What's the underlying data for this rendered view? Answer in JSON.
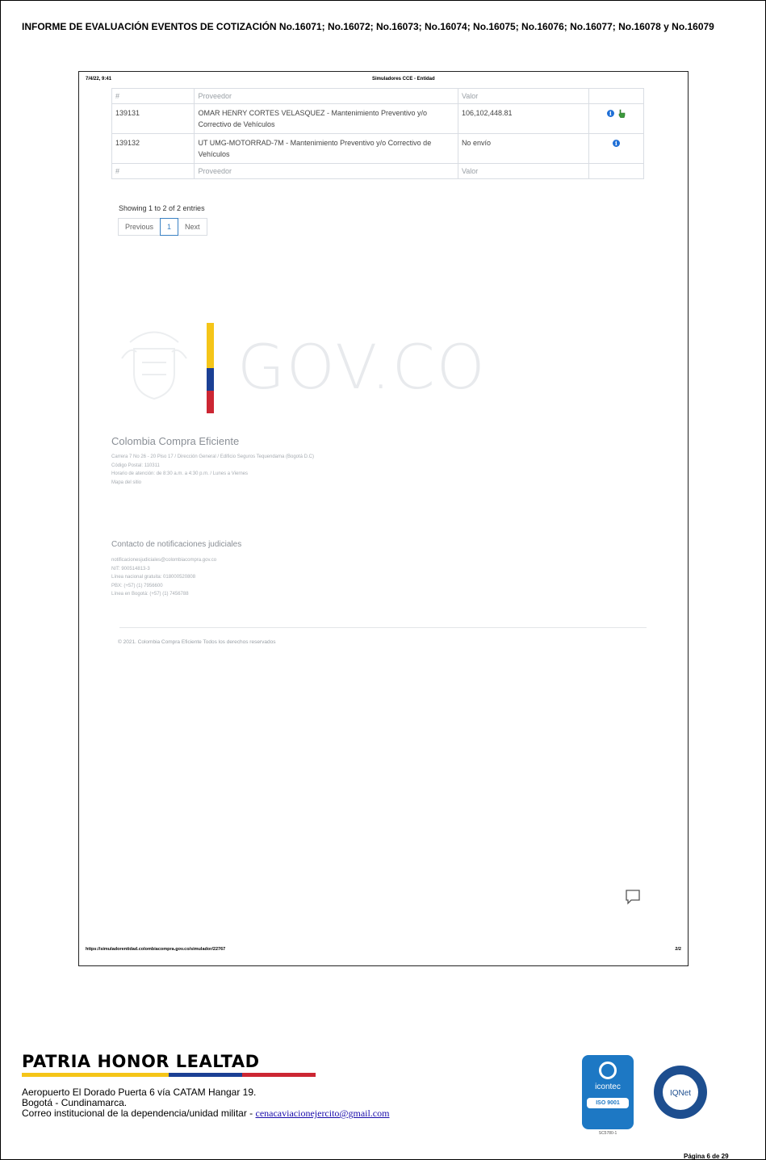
{
  "report": {
    "title": "INFORME DE EVALUACIÓN EVENTOS DE COTIZACIÓN No.16071; No.16072; No.16073; No.16074; No.16075; No.16076; No.16077; No.16078 y No.16079"
  },
  "print_header": {
    "date": "7/4/22, 9:41",
    "site": "Simuladores CCE - Entidad"
  },
  "table": {
    "headers": [
      "#",
      "Proveedor",
      "Valor",
      ""
    ],
    "rows": [
      {
        "id": "139131",
        "proveedor": "OMAR HENRY CORTES VELASQUEZ - Mantenimiento Preventivo y/o Correctivo de Vehículos",
        "valor": "106,102,448.81",
        "icons": [
          "info-icon",
          "hand-pointer-icon"
        ]
      },
      {
        "id": "139132",
        "proveedor": "UT UMG-MOTORRAD-7M - Mantenimiento Preventivo y/o Correctivo de Vehículos",
        "valor": "No envío",
        "icons": [
          "info-icon"
        ]
      }
    ],
    "footers": [
      "#",
      "Proveedor",
      "Valor",
      ""
    ]
  },
  "pagination": {
    "showing": "Showing 1 to 2 of 2 entries",
    "previous": "Previous",
    "current": "1",
    "next": "Next"
  },
  "govco": {
    "text": "GOV.CO",
    "flag_colors": [
      "#f5c518",
      "#1b3f94",
      "#cc2633"
    ]
  },
  "cce": {
    "title": "Colombia Compra Eficiente",
    "lines": [
      "Carrera 7 No 26 - 20 Piso 17 / Dirección General / Edificio Seguros Tequendama (Bogotá D.C)",
      "Código Postal: 110311",
      "Horario de atención: de 8:30 a.m. a 4:30 p.m. / Lunes a Viernes",
      "Mapa del sitio"
    ]
  },
  "notifications": {
    "title": "Contacto de notificaciones judiciales",
    "lines": [
      "notificacionesjudiciales@colombiacompra.gov.co",
      "NIT: 900514813-3",
      "Línea nacional gratuita: 018000520808",
      "PBX: (+57) (1) 7956600",
      "Línea en Bogotá: (+57) (1) 7456788"
    ]
  },
  "copyright": "© 2021. Colombia Compra Eficiente Todos los derechos reservados",
  "print_footer": {
    "url": "https://simuladorentidad.colombiacompra.gov.co/simulador/22767",
    "page": "2/2"
  },
  "footer": {
    "motto": "PATRIA HONOR LEALTAD",
    "address_line1": "Aeropuerto El Dorado Puerta 6 vía CATAM Hangar 19.",
    "address_line2": "Bogotá - Cundinamarca.",
    "email_prefix": "Correo institucional de la dependencia/unidad militar - ",
    "email": "cenacaviacionejercito@gmail.com",
    "icontec_name": "icontec",
    "iso": "ISO 9001",
    "icontec_code": "SC5780-1",
    "iqnet": "IQNet",
    "page_label": "Página 6 de 29"
  },
  "colors": {
    "accent_blue": "#1d78c4",
    "flag_yellow": "#f5c518",
    "flag_blue": "#1b3f94",
    "flag_red": "#cc2633"
  }
}
